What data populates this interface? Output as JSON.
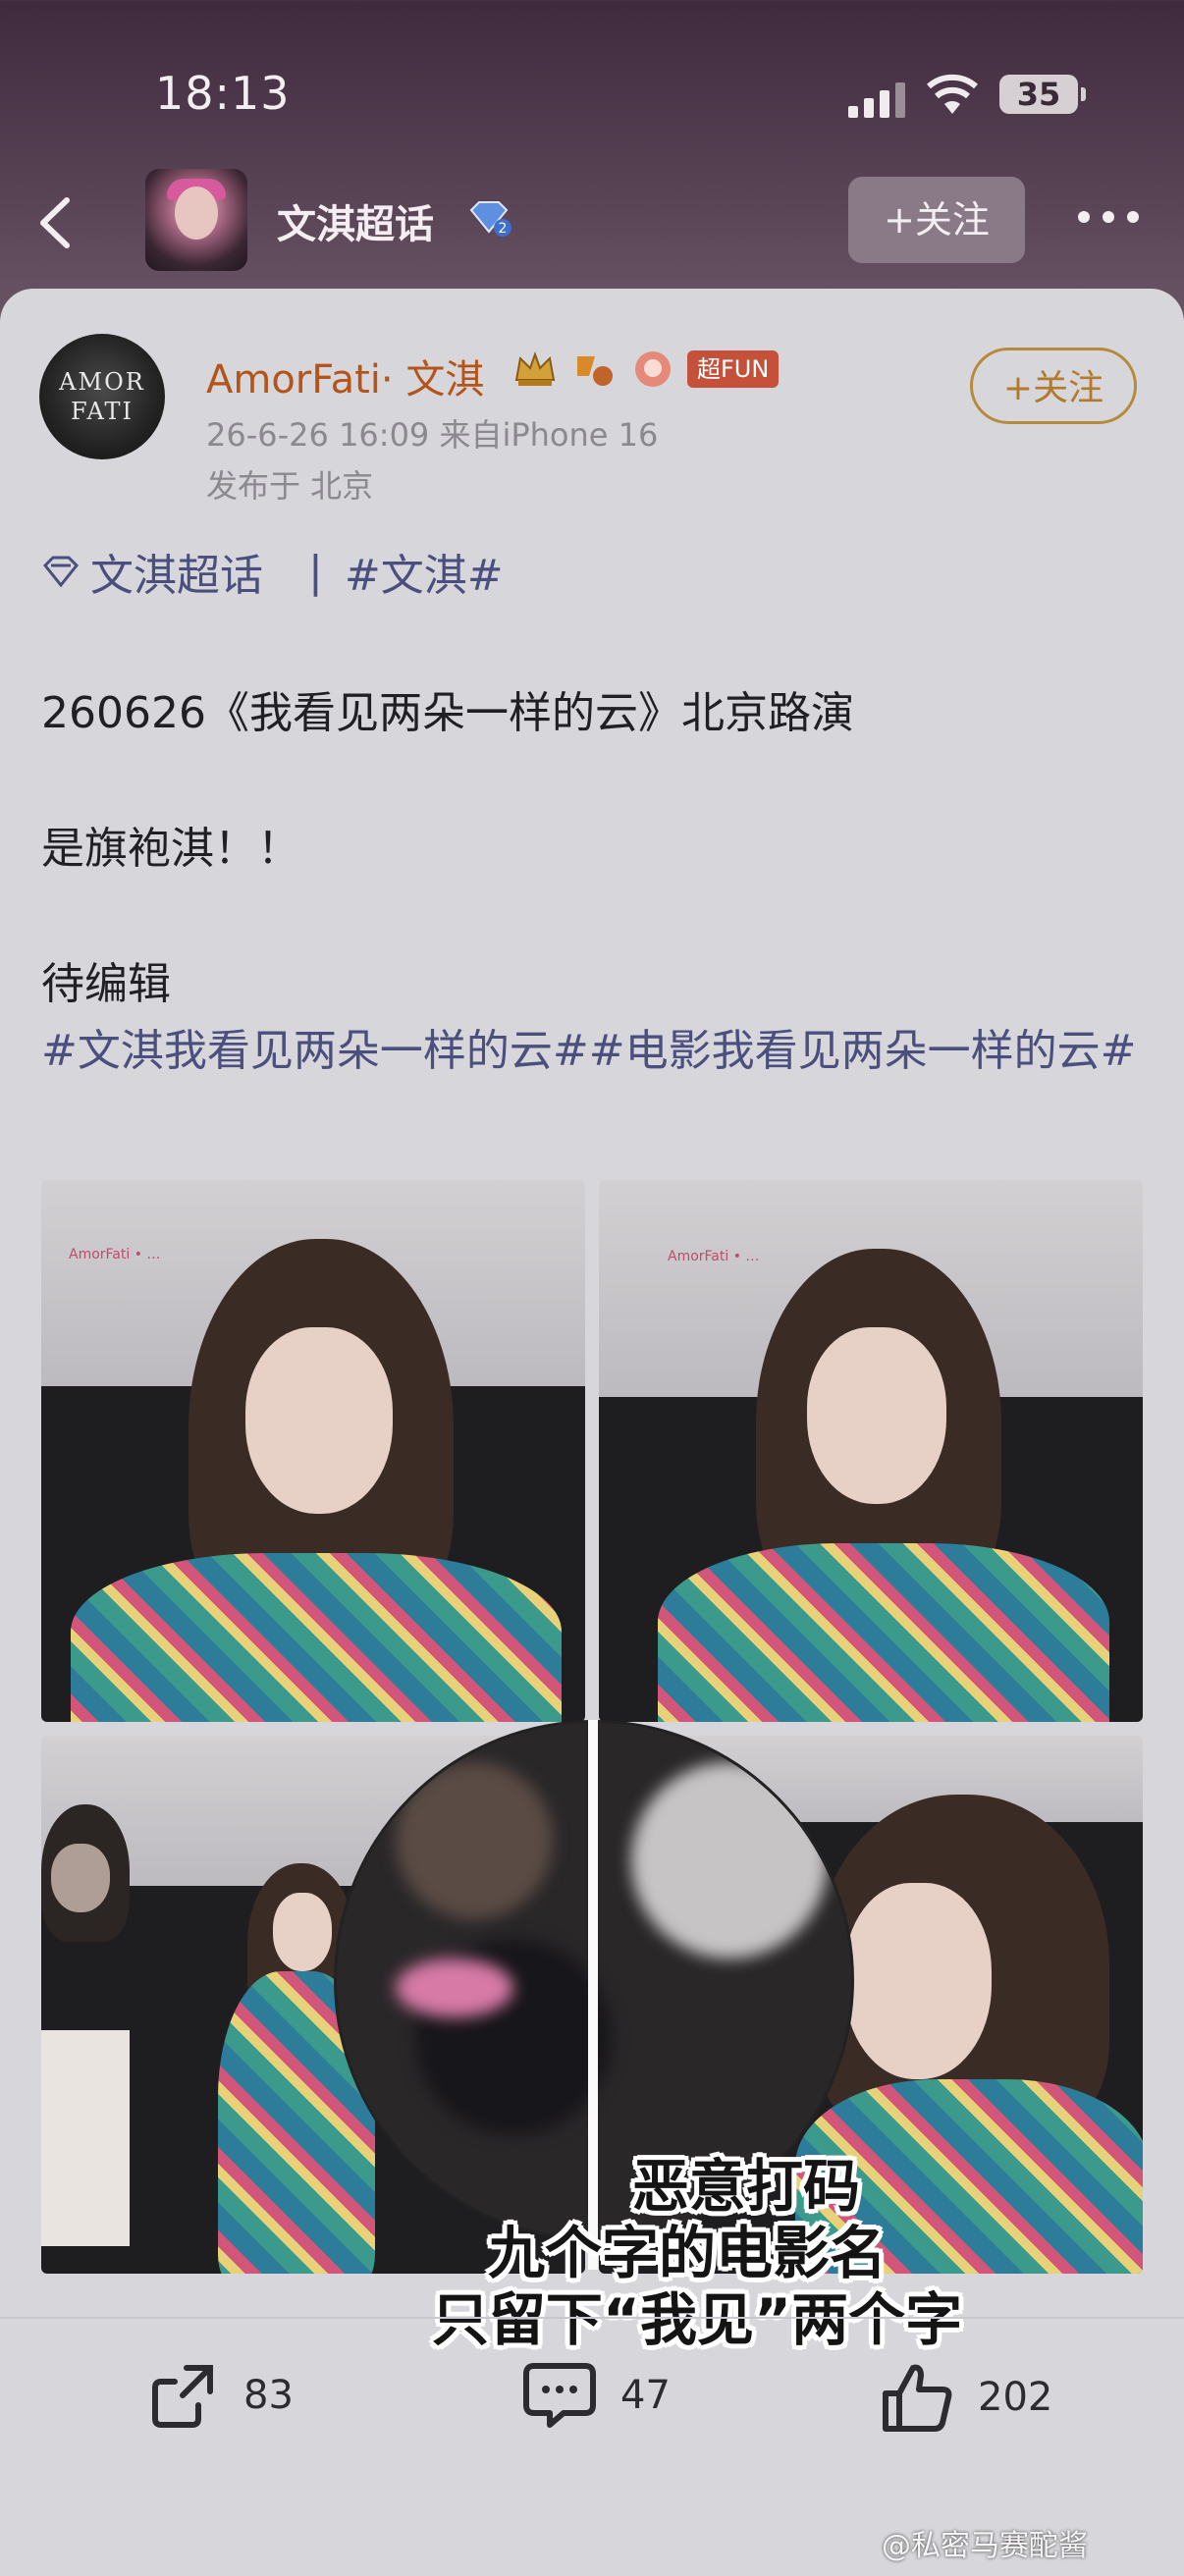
{
  "status_bar": {
    "time": "18:13",
    "battery": "35"
  },
  "topbar": {
    "title": "文淇超话",
    "badge_level": "2",
    "follow_label": "+关注"
  },
  "post": {
    "author": "AmorFati· 文淇",
    "avatar_text": "AMOR FATI",
    "fun_badge": "超FUN",
    "meta_time": "26-6-26 16:09  来自iPhone 16",
    "meta_location": "发布于 北京",
    "follow_label": "+关注",
    "topic": "文淇超话",
    "topic_sep": "|",
    "hashtag": "#文淇#",
    "line1": "260626《我看见两朵一样的云》北京路演",
    "line2": "是旗袍淇！！",
    "line3": "待编辑",
    "hashtags_line": "#文淇我看见两朵一样的云##电影我看见两朵一样的云#"
  },
  "overlay_text": {
    "line1": "恶意打码",
    "line2": "九个字的电影名",
    "line3": "只留下“我见”两个字"
  },
  "actions": {
    "share_count": "83",
    "comment_count": "47",
    "like_count": "202"
  },
  "watermark": "@私密马赛酡酱",
  "colors": {
    "author": "#b3551b",
    "topic": "#4a4f7e",
    "card_bg": "#d7d6db",
    "follow_border": "#b58a3a"
  }
}
